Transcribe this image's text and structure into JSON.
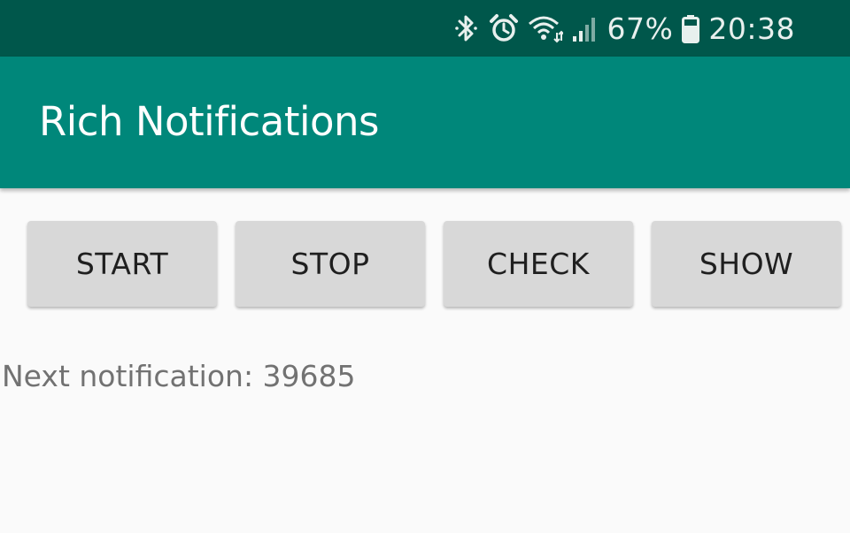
{
  "status_bar": {
    "icons": [
      "bluetooth-icon",
      "alarm-icon",
      "wifi-icon",
      "cellular-signal-icon",
      "battery-icon"
    ],
    "battery_percent": "67%",
    "time": "20:38",
    "background": "#00574b"
  },
  "app_bar": {
    "title": "Rich Notifications",
    "background": "#00877a"
  },
  "buttons": {
    "start_label": "START",
    "stop_label": "STOP",
    "check_label": "CHECK",
    "show_label": "SHOW"
  },
  "content": {
    "next_notification": "Next notification: 39685"
  }
}
